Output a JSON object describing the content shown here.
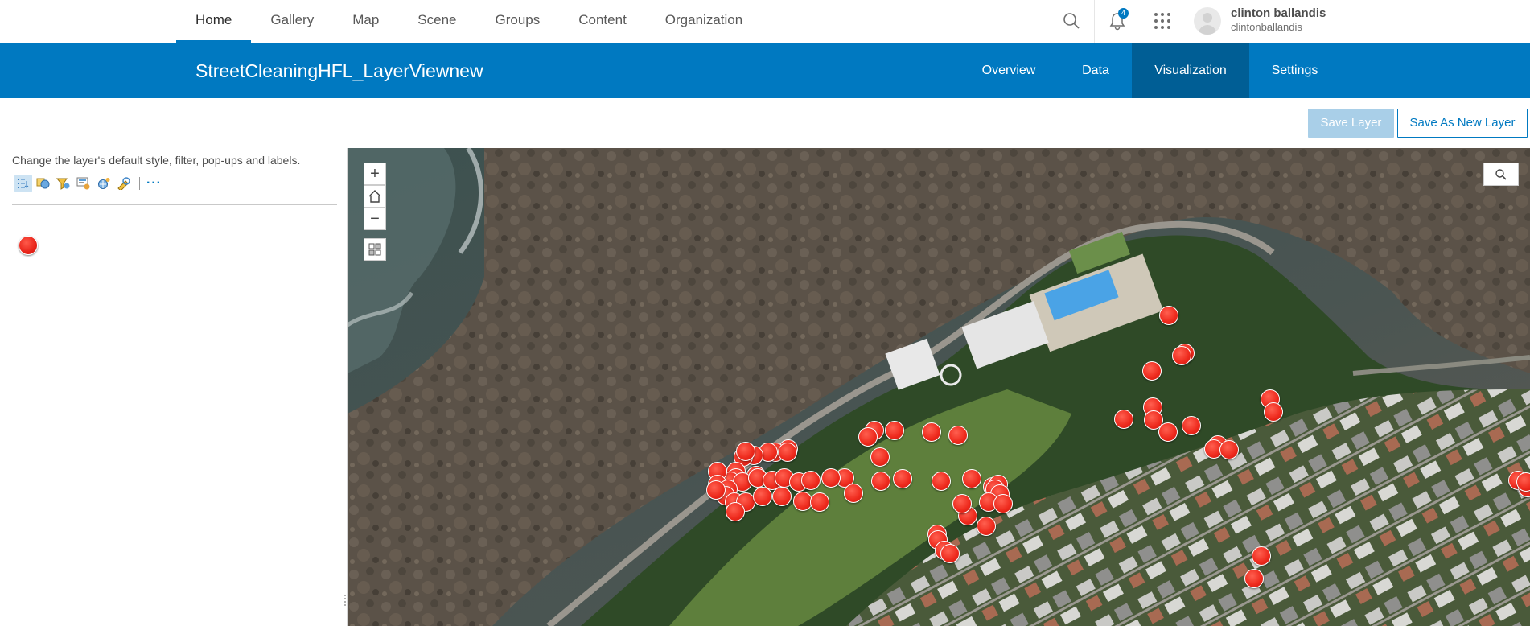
{
  "topnav": {
    "items": [
      {
        "label": "Home",
        "active": true
      },
      {
        "label": "Gallery"
      },
      {
        "label": "Map"
      },
      {
        "label": "Scene"
      },
      {
        "label": "Groups"
      },
      {
        "label": "Content"
      },
      {
        "label": "Organization"
      }
    ],
    "notification_count": "4",
    "user": {
      "full_name": "clinton ballandis",
      "username": "clintonballandis"
    },
    "icons": [
      "search-icon",
      "bell-icon",
      "app-launcher-icon",
      "avatar"
    ]
  },
  "item_header": {
    "title": "StreetCleaningHFL_LayerViewnew",
    "tabs": [
      {
        "label": "Overview"
      },
      {
        "label": "Data"
      },
      {
        "label": "Visualization",
        "active": true
      },
      {
        "label": "Settings"
      }
    ]
  },
  "actions": {
    "save_label": "Save Layer",
    "save_as_label": "Save As New Layer"
  },
  "left_panel": {
    "description": "Change the layer's default style, filter, pop-ups and labels.",
    "toolbar_icons": [
      "layer-list-icon",
      "change-style-icon",
      "filter-icon",
      "configure-popup-icon",
      "labels-icon",
      "analysis-icon"
    ],
    "more_label": "···"
  },
  "map": {
    "controls": [
      "zoom-in",
      "home",
      "zoom-out",
      "basemap-gallery",
      "search"
    ],
    "zoom_in_label": "+",
    "zoom_out_label": "−"
  },
  "colors": {
    "brand_blue": "#0079c1",
    "active_tab": "#005e95",
    "marker_red": "#ee2a1d"
  }
}
